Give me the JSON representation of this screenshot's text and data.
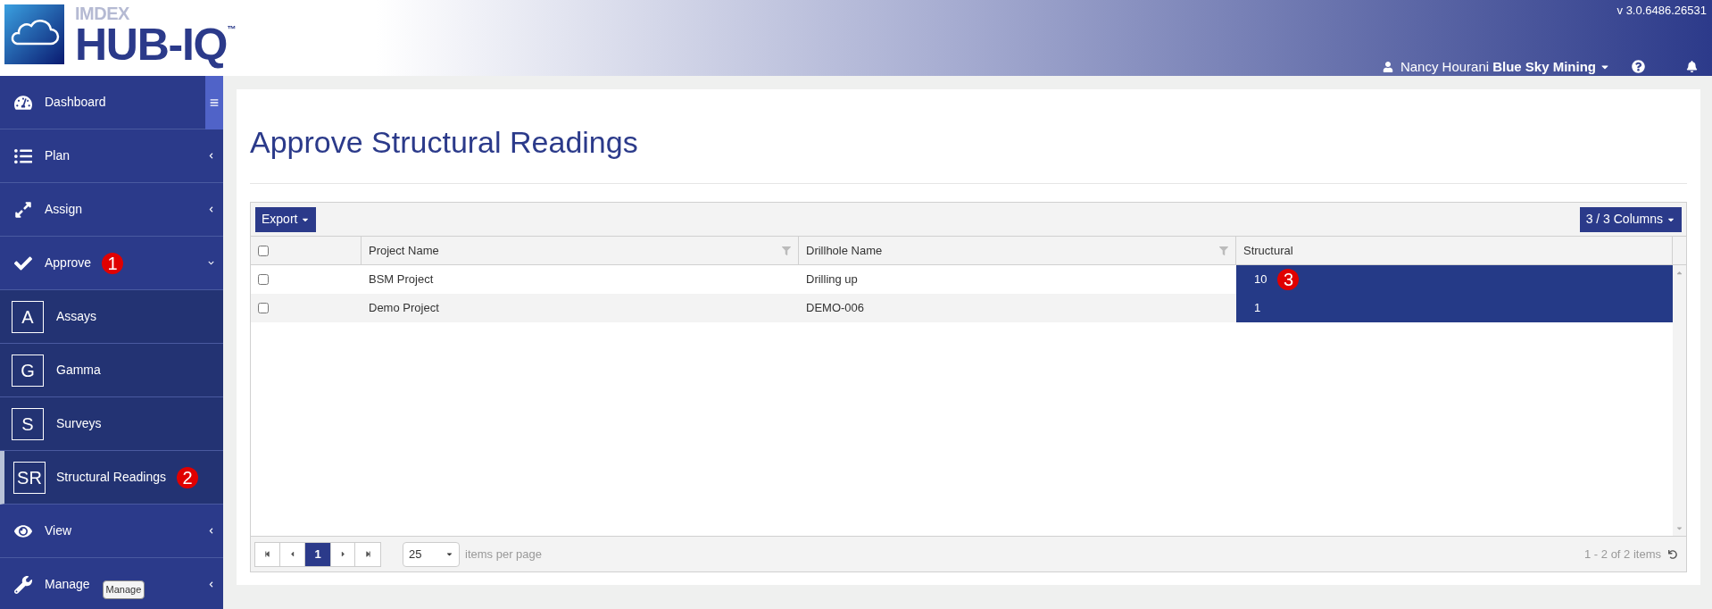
{
  "header": {
    "brand_small": "IMDEX",
    "brand": "HUB-IQ",
    "trademark": "™",
    "version": "v 3.0.6486.26531",
    "user": "Nancy Hourani",
    "company": "Blue Sky Mining"
  },
  "sidebar": {
    "items": [
      {
        "kind": "main",
        "label": "Dashboard",
        "selected": false
      },
      {
        "kind": "main",
        "label": "Plan",
        "expanded": false,
        "selected": false
      },
      {
        "kind": "main",
        "label": "Assign",
        "expanded": false,
        "selected": false
      },
      {
        "kind": "main",
        "label": "Approve",
        "expanded": true,
        "selected": false,
        "callout": "1"
      },
      {
        "kind": "sub",
        "letter": "A",
        "label": "Assays",
        "selected": false
      },
      {
        "kind": "sub",
        "letter": "G",
        "label": "Gamma",
        "selected": false
      },
      {
        "kind": "sub",
        "letter": "S",
        "label": "Surveys",
        "selected": false
      },
      {
        "kind": "sub",
        "letter": "SR",
        "label": "Structural Readings",
        "selected": true,
        "callout": "2"
      },
      {
        "kind": "main",
        "label": "View",
        "expanded": false,
        "selected": false
      },
      {
        "kind": "main",
        "label": "Manage",
        "expanded": false,
        "selected": false,
        "tooltip": "Manage"
      }
    ]
  },
  "page": {
    "title": "Approve Structural Readings"
  },
  "grid": {
    "all_checked": false,
    "export": "Export",
    "columns_button": "3 / 3 Columns",
    "columns": [
      {
        "label": "Project Name",
        "filter": true
      },
      {
        "label": "Drillhole Name",
        "filter": true
      },
      {
        "label": "Structural",
        "filter": false
      }
    ],
    "rows": [
      {
        "checked": false,
        "project": "BSM Project",
        "drillhole": "Drilling up",
        "structural": {
          "text": "10",
          "selected": true,
          "callout": "3"
        }
      },
      {
        "checked": false,
        "project": "Demo Project",
        "drillhole": "DEMO-006",
        "structural": {
          "text": "1",
          "selected": true
        }
      }
    ],
    "pager": {
      "page": "1",
      "page_size": "25",
      "per_page_label": "items per page",
      "summary": "1 - 2 of 2 items"
    }
  }
}
